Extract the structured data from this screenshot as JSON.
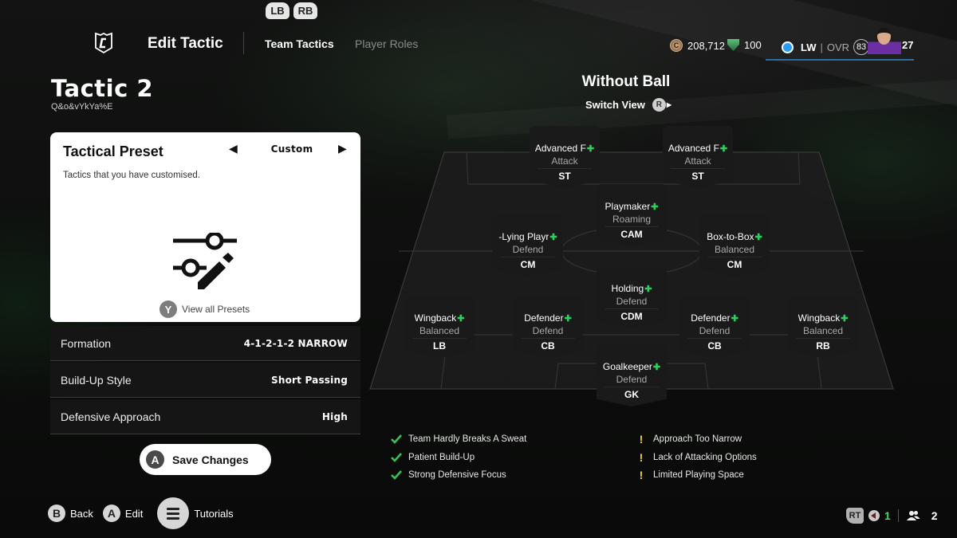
{
  "bumpers": {
    "left": "LB",
    "right": "RB"
  },
  "header": {
    "title": "Edit Tactic",
    "tabs": [
      {
        "label": "Team Tactics",
        "active": true
      },
      {
        "label": "Player Roles",
        "active": false
      }
    ],
    "coins": "208,712",
    "points": "100",
    "player": {
      "position": "LW",
      "ovr_label": "OVR",
      "ovr": "83",
      "level": "27"
    }
  },
  "tactic": {
    "name": "Tactic 2",
    "code": "Q&o&vYkYa%E"
  },
  "preset": {
    "title": "Tactical Preset",
    "value": "Custom",
    "description": "Tactics that you have customised.",
    "view_all_button": "Y",
    "view_all_label": "View all Presets"
  },
  "settings": [
    {
      "label": "Formation",
      "value": "4-1-2-1-2 NARROW"
    },
    {
      "label": "Build-Up Style",
      "value": "Short Passing"
    },
    {
      "label": "Defensive Approach",
      "value": "High"
    }
  ],
  "save": {
    "button": "A",
    "label": "Save Changes"
  },
  "footer": {
    "back": {
      "button": "B",
      "label": "Back"
    },
    "edit": {
      "button": "A",
      "label": "Edit"
    },
    "tutorials": {
      "label": "Tutorials"
    }
  },
  "status": {
    "rt": "RT",
    "voice_count": "1",
    "party_count": "2"
  },
  "pitch": {
    "view_title": "Without Ball",
    "switch_label": "Switch View",
    "switch_button": "R",
    "players": [
      {
        "role": "Advanced Forward",
        "role_shown": "Advanced F",
        "focus": "Attack",
        "pos": "ST"
      },
      {
        "role": "Advanced Forward",
        "role_shown": "Advanced F",
        "focus": "Attack",
        "pos": "ST"
      },
      {
        "role": "Playmaker",
        "role_shown": "Playmaker",
        "focus": "Roaming",
        "pos": "CAM"
      },
      {
        "role": "Deep-Lying Playmaker",
        "role_shown": "-Lying Playr",
        "focus": "Defend",
        "pos": "CM"
      },
      {
        "role": "Box-to-Box",
        "role_shown": "Box-to-Box",
        "focus": "Balanced",
        "pos": "CM"
      },
      {
        "role": "Holding",
        "role_shown": "Holding",
        "focus": "Defend",
        "pos": "CDM"
      },
      {
        "role": "Wingback",
        "role_shown": "Wingback",
        "focus": "Balanced",
        "pos": "LB"
      },
      {
        "role": "Defender",
        "role_shown": "Defender",
        "focus": "Defend",
        "pos": "CB"
      },
      {
        "role": "Defender",
        "role_shown": "Defender",
        "focus": "Defend",
        "pos": "CB"
      },
      {
        "role": "Wingback",
        "role_shown": "Wingback",
        "focus": "Balanced",
        "pos": "RB"
      },
      {
        "role": "Goalkeeper",
        "role_shown": "Goalkeeper",
        "focus": "Defend",
        "pos": "GK"
      }
    ]
  },
  "feedback": {
    "strengths": [
      "Team Hardly Breaks A Sweat",
      "Patient Build-Up",
      "Strong Defensive Focus"
    ],
    "weaknesses": [
      "Approach Too Narrow",
      "Lack of Attacking Options",
      "Limited Playing Space"
    ]
  },
  "colors": {
    "accent_green": "#2ecf5d",
    "warning_yellow": "#f2d43a",
    "position_blue": "#2b9cf0"
  }
}
